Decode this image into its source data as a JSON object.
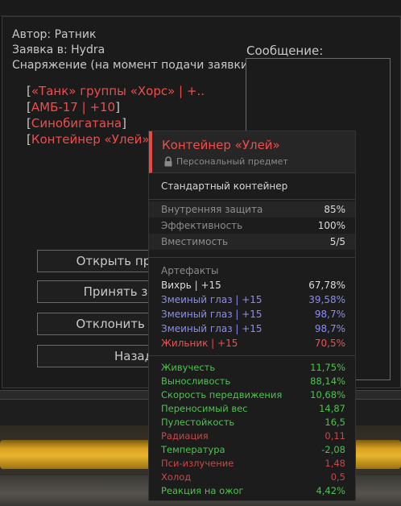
{
  "request": {
    "author": "Автор: Ратник",
    "request_to": "Заявка в: Hydra",
    "equipment_label": "Снаряжение (на момент подачи заявки):",
    "equipment": [
      "«Танк» группы «Хорс» | +..",
      "АМБ-17 | +10",
      "Синобигатана",
      "Контейнер «Улей»"
    ],
    "message_label": "Сообщение:"
  },
  "buttons": {
    "open_profile": "Открыть профиль",
    "accept": "Принять заявку",
    "decline": "Отклонить заявку",
    "back": "Назад"
  },
  "tooltip": {
    "title": "Контейнер «Улей»",
    "subtitle": "Персональный предмет",
    "type": "Стандартный контейнер",
    "base_stats": [
      {
        "label": "Внутренняя защита",
        "value": "85%"
      },
      {
        "label": "Эффективность",
        "value": "100%"
      },
      {
        "label": "Вместимость",
        "value": "5/5"
      }
    ],
    "artifacts_label": "Артефакты",
    "artifacts": [
      {
        "label": "Вихрь | +15",
        "value": "67,78%",
        "color": "#dcdcdc"
      },
      {
        "label": "Змеиный глаз | +15",
        "value": "39,58%",
        "color": "#8c8cf0"
      },
      {
        "label": "Змеиный глаз | +15",
        "value": "98,7%",
        "color": "#8c8cf0"
      },
      {
        "label": "Змеиный глаз | +15",
        "value": "98,7%",
        "color": "#8c8cf0"
      },
      {
        "label": "Жильник | +15",
        "value": "70,5%",
        "color": "#f05050"
      }
    ],
    "effects": [
      {
        "label": "Живучесть",
        "value": "11,75%",
        "color": "#4ec24e"
      },
      {
        "label": "Выносливость",
        "value": "88,14%",
        "color": "#4ec24e"
      },
      {
        "label": "Скорость передвижения",
        "value": "10,68%",
        "color": "#4ec24e"
      },
      {
        "label": "Переносимый вес",
        "value": "14,87",
        "color": "#4ec24e"
      },
      {
        "label": "Пулестойкость",
        "value": "16,5",
        "color": "#4ec24e"
      },
      {
        "label": "Радиация",
        "value": "0,11",
        "color": "#c84848"
      },
      {
        "label": "Температура",
        "value": "-2,08",
        "color": "#4ec24e"
      },
      {
        "label": "Пси-излучение",
        "value": "1,48",
        "color": "#c84848"
      },
      {
        "label": "Холод",
        "value": "0,5",
        "color": "#c84848"
      },
      {
        "label": "Реакция на ожог",
        "value": "4,42%",
        "color": "#4ec24e"
      }
    ]
  }
}
